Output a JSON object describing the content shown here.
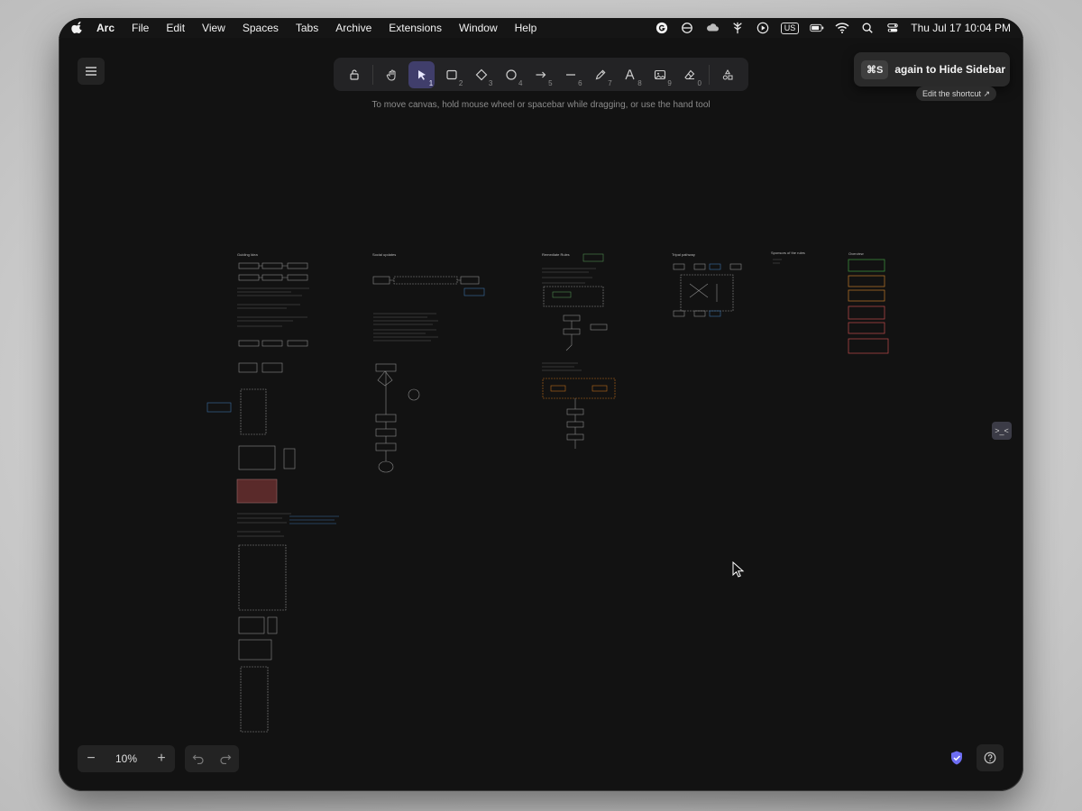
{
  "menubar": {
    "app": "Arc",
    "items": [
      "File",
      "Edit",
      "View",
      "Spaces",
      "Tabs",
      "Archive",
      "Extensions",
      "Window",
      "Help"
    ],
    "input_source": "US",
    "clock": "Thu Jul 17  10:04 PM"
  },
  "toolbar": {
    "tools": [
      {
        "name": "lock",
        "key": ""
      },
      {
        "name": "hand",
        "key": ""
      },
      {
        "name": "selection",
        "key": "1"
      },
      {
        "name": "rectangle",
        "key": "2"
      },
      {
        "name": "diamond",
        "key": "3"
      },
      {
        "name": "ellipse",
        "key": "4"
      },
      {
        "name": "arrow",
        "key": "5"
      },
      {
        "name": "line",
        "key": "6"
      },
      {
        "name": "draw",
        "key": "7"
      },
      {
        "name": "text",
        "key": "8"
      },
      {
        "name": "image",
        "key": "9"
      },
      {
        "name": "eraser",
        "key": "0"
      },
      {
        "name": "more-shapes",
        "key": ""
      }
    ],
    "active_tool": "selection",
    "hint": "To move canvas, hold mouse wheel or spacebar while dragging, or use the hand tool"
  },
  "tooltip": {
    "shortcut": "⌘S",
    "text": "again to Hide Sidebar",
    "edit_link": "Edit the shortcut ↗"
  },
  "canvas": {
    "section_titles": [
      "Guiding Idea",
      "Social updates",
      "Remediate Rules",
      "Tripal pathway",
      "Sponsors of the rules",
      "Overview"
    ]
  },
  "side_tab": {
    "label": ">_<"
  },
  "zoom": {
    "value": "10%",
    "minus": "−",
    "plus": "+"
  },
  "colors": {
    "accent": "#403e6b",
    "window_bg": "#121212",
    "panel_bg": "#232325",
    "shield": "#6d6df2"
  }
}
